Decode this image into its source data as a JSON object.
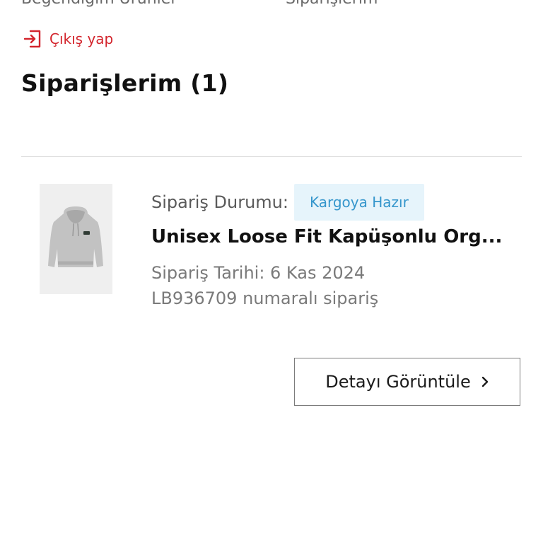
{
  "top_links": {
    "left": "Beğendiğim Ürünler",
    "right": "Siparişlerim"
  },
  "logout": {
    "label": "Çıkış yap",
    "icon": "logout-icon",
    "color": "#d3252d"
  },
  "page_title": "Siparişlerim (1)",
  "order": {
    "status_label": "Sipariş Durumu:",
    "status_value": "Kargoya Hazır",
    "product_name": "Unisex Loose Fit Kapüşonlu Org...",
    "date": "Sipariş Tarihi: 6 Kas 2024",
    "number": "LB936709 numaralı sipariş",
    "image": "grey-hoodie-product-image"
  },
  "detail_button": {
    "label": "Detayı Görüntüle",
    "icon": "chevron-right-icon"
  },
  "colors": {
    "accent_red": "#d3252d",
    "status_badge_bg": "#e6f4fb",
    "status_badge_text": "#3596cc"
  }
}
